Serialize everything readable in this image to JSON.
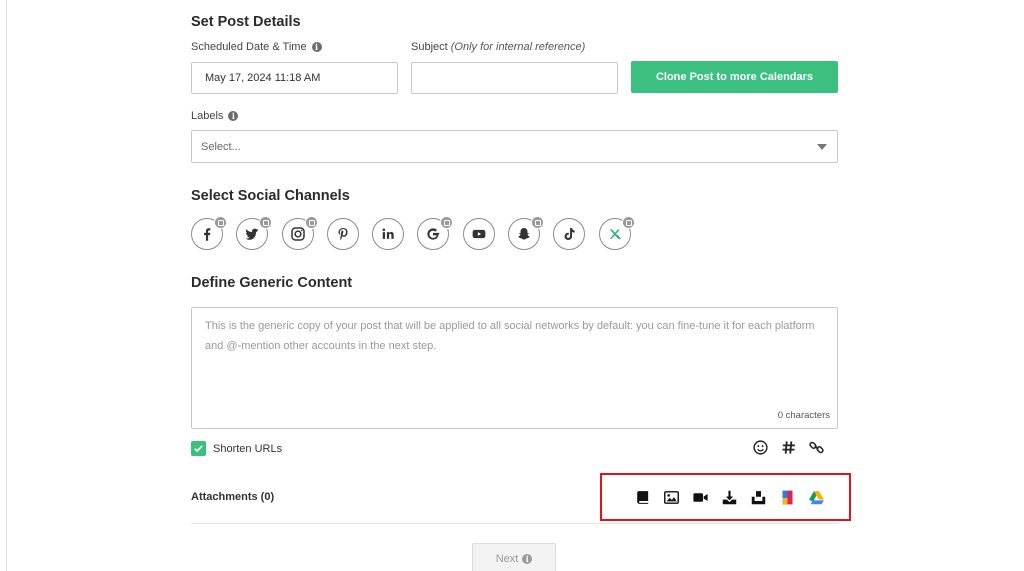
{
  "post_details": {
    "title": "Set Post Details",
    "scheduled_label": "Scheduled Date & Time",
    "scheduled_value": "May 17, 2024 11:18 AM",
    "subject_label": "Subject",
    "subject_hint": "(Only for internal reference)",
    "subject_value": "",
    "clone_button": "Clone Post to more Calendars",
    "labels_label": "Labels",
    "labels_placeholder": "Select..."
  },
  "channels": {
    "title": "Select Social Channels",
    "items": [
      {
        "name": "facebook",
        "icon": "facebook-icon"
      },
      {
        "name": "twitter",
        "icon": "twitter-icon"
      },
      {
        "name": "instagram",
        "icon": "instagram-icon"
      },
      {
        "name": "pinterest",
        "icon": "pinterest-icon"
      },
      {
        "name": "linkedin",
        "icon": "linkedin-icon"
      },
      {
        "name": "google-business",
        "icon": "google-icon"
      },
      {
        "name": "youtube",
        "icon": "youtube-icon"
      },
      {
        "name": "snapchat",
        "icon": "snapchat-icon"
      },
      {
        "name": "tiktok",
        "icon": "tiktok-icon"
      },
      {
        "name": "custom-x",
        "icon": "x-icon"
      }
    ]
  },
  "content": {
    "title": "Define Generic Content",
    "placeholder": "This is the generic copy of your post that will be applied to all social networks by default: you can fine-tune it for each platform and @-mention other accounts in the next step.",
    "char_count": "0 characters",
    "shorten_urls_label": "Shorten URLs",
    "shorten_urls_checked": true
  },
  "attachments": {
    "label": "Attachments (0)",
    "icons": [
      "book-icon",
      "image-icon",
      "video-icon",
      "download-icon",
      "upload-tray-icon",
      "notebook-icon",
      "google-drive-icon"
    ]
  },
  "footer": {
    "next_label": "Next"
  },
  "colors": {
    "accent": "#3cc07f",
    "highlight": "#e0151b"
  }
}
